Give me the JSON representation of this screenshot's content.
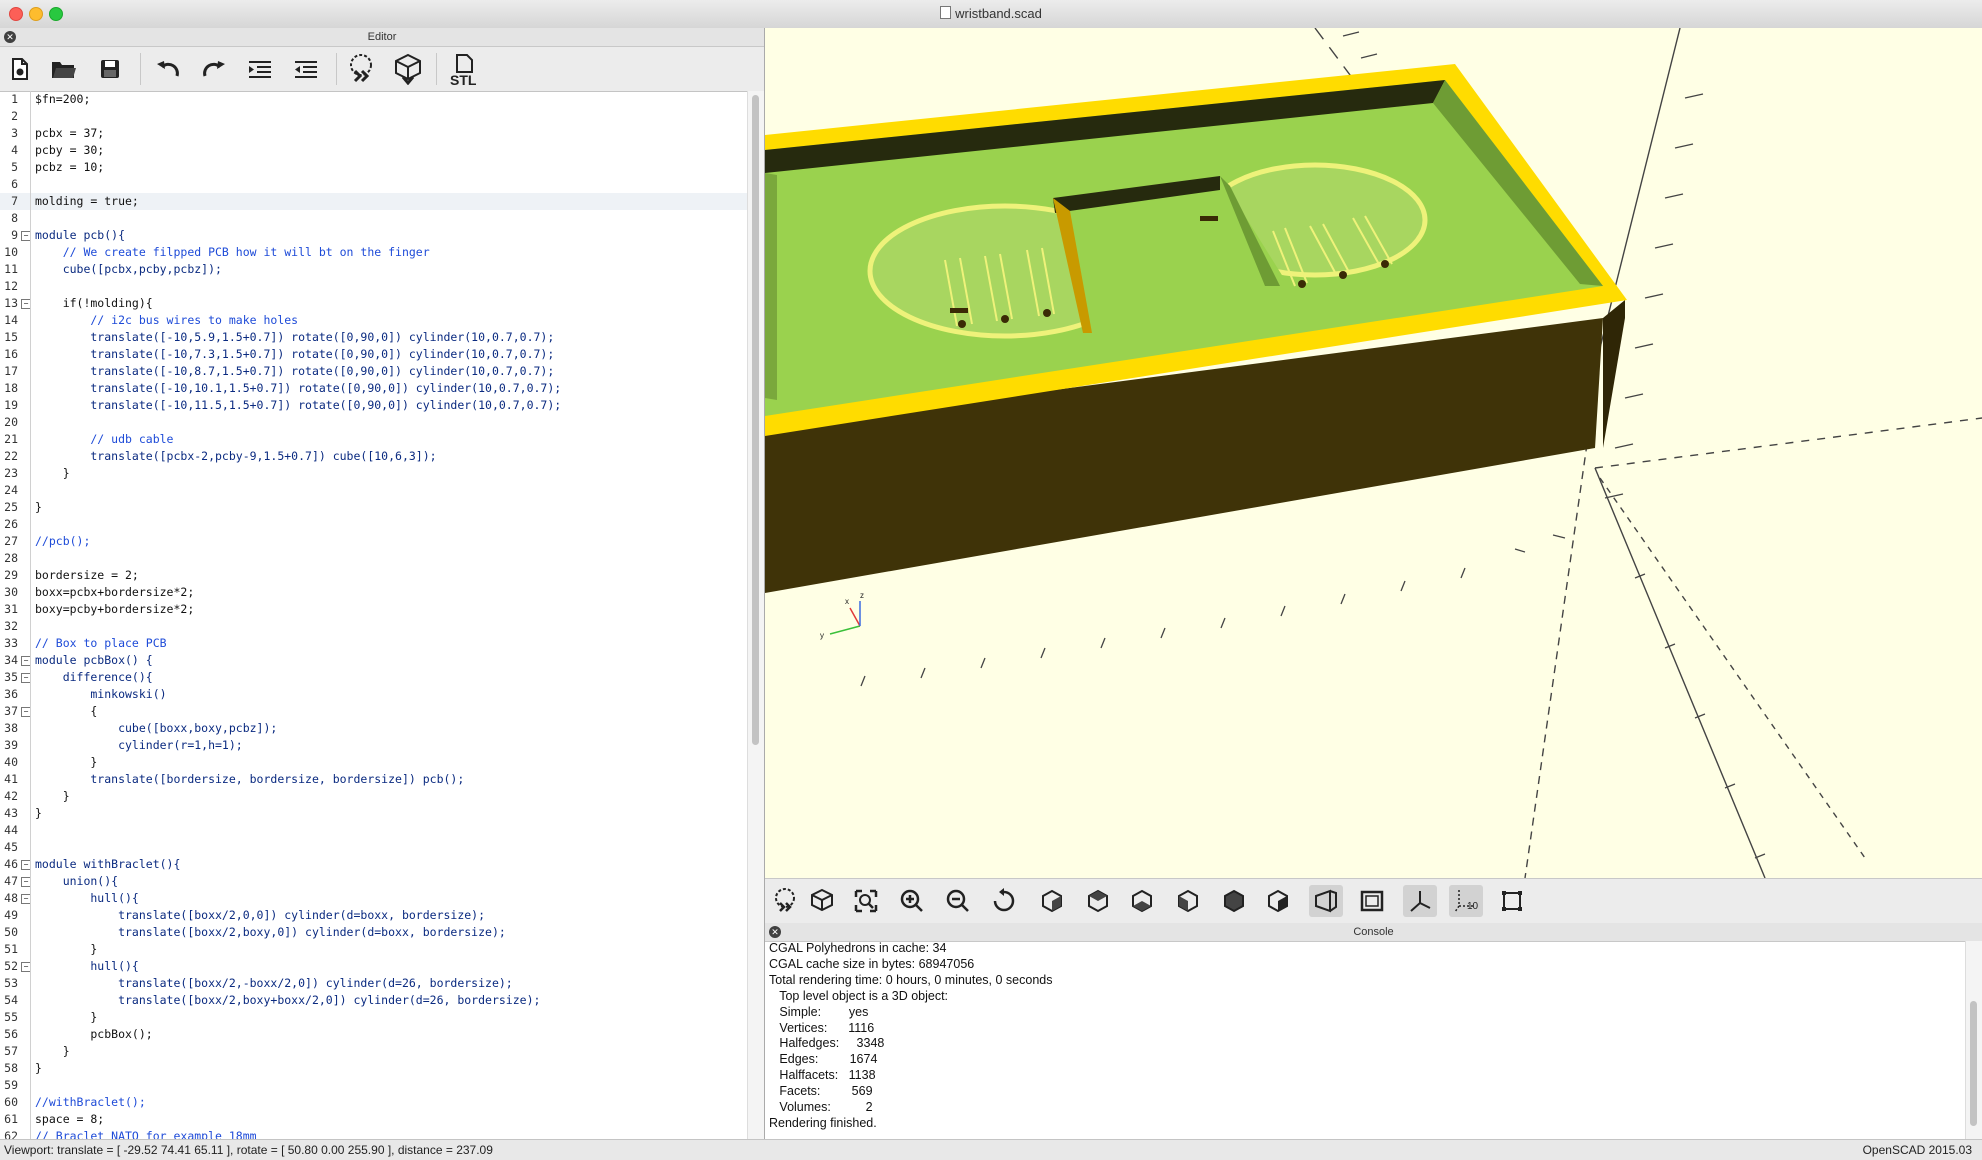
{
  "window": {
    "title": "wristband.scad"
  },
  "editor": {
    "title": "Editor",
    "toolbar": [
      "new-file-icon",
      "open-file-icon",
      "save-icon",
      "undo-icon",
      "redo-icon",
      "indent-icon",
      "unindent-icon",
      "preview-icon",
      "render-icon",
      "export-stl-icon"
    ],
    "stl_label": "STL",
    "lines": [
      {
        "n": "1",
        "t": "$fn=200;"
      },
      {
        "n": "2",
        "t": ""
      },
      {
        "n": "3",
        "t": "pcbx = 37;"
      },
      {
        "n": "4",
        "t": "pcby = 30;"
      },
      {
        "n": "5",
        "t": "pcbz = 10;"
      },
      {
        "n": "6",
        "t": ""
      },
      {
        "n": "7",
        "t": "molding = true;"
      },
      {
        "n": "8",
        "t": ""
      },
      {
        "n": "9",
        "t": "module pcb(){",
        "fold": true
      },
      {
        "n": "10",
        "t": "    // We create filpped PCB how it will bt on the finger"
      },
      {
        "n": "11",
        "t": "    cube([pcbx,pcby,pcbz]);"
      },
      {
        "n": "12",
        "t": ""
      },
      {
        "n": "13",
        "t": "    if(!molding){",
        "fold": true
      },
      {
        "n": "14",
        "t": "        // i2c bus wires to make holes"
      },
      {
        "n": "15",
        "t": "        translate([-10,5.9,1.5+0.7]) rotate([0,90,0]) cylinder(10,0.7,0.7);"
      },
      {
        "n": "16",
        "t": "        translate([-10,7.3,1.5+0.7]) rotate([0,90,0]) cylinder(10,0.7,0.7);"
      },
      {
        "n": "17",
        "t": "        translate([-10,8.7,1.5+0.7]) rotate([0,90,0]) cylinder(10,0.7,0.7);"
      },
      {
        "n": "18",
        "t": "        translate([-10,10.1,1.5+0.7]) rotate([0,90,0]) cylinder(10,0.7,0.7);"
      },
      {
        "n": "19",
        "t": "        translate([-10,11.5,1.5+0.7]) rotate([0,90,0]) cylinder(10,0.7,0.7);"
      },
      {
        "n": "20",
        "t": ""
      },
      {
        "n": "21",
        "t": "        // udb cable"
      },
      {
        "n": "22",
        "t": "        translate([pcbx-2,pcby-9,1.5+0.7]) cube([10,6,3]);"
      },
      {
        "n": "23",
        "t": "    }"
      },
      {
        "n": "24",
        "t": ""
      },
      {
        "n": "25",
        "t": "}"
      },
      {
        "n": "26",
        "t": ""
      },
      {
        "n": "27",
        "t": "//pcb();"
      },
      {
        "n": "28",
        "t": ""
      },
      {
        "n": "29",
        "t": "bordersize = 2;"
      },
      {
        "n": "30",
        "t": "boxx=pcbx+bordersize*2;"
      },
      {
        "n": "31",
        "t": "boxy=pcby+bordersize*2;"
      },
      {
        "n": "32",
        "t": ""
      },
      {
        "n": "33",
        "t": "// Box to place PCB"
      },
      {
        "n": "34",
        "t": "module pcbBox() {",
        "fold": true
      },
      {
        "n": "35",
        "t": "    difference(){",
        "fold": true
      },
      {
        "n": "36",
        "t": "        minkowski()"
      },
      {
        "n": "37",
        "t": "        {",
        "fold": true
      },
      {
        "n": "38",
        "t": "            cube([boxx,boxy,pcbz]);"
      },
      {
        "n": "39",
        "t": "            cylinder(r=1,h=1);"
      },
      {
        "n": "40",
        "t": "        }"
      },
      {
        "n": "41",
        "t": "        translate([bordersize, bordersize, bordersize]) pcb();"
      },
      {
        "n": "42",
        "t": "    }"
      },
      {
        "n": "43",
        "t": "}"
      },
      {
        "n": "44",
        "t": ""
      },
      {
        "n": "45",
        "t": ""
      },
      {
        "n": "46",
        "t": "module withBraclet(){",
        "fold": true
      },
      {
        "n": "47",
        "t": "    union(){",
        "fold": true
      },
      {
        "n": "48",
        "t": "        hull(){",
        "fold": true
      },
      {
        "n": "49",
        "t": "            translate([boxx/2,0,0]) cylinder(d=boxx, bordersize);"
      },
      {
        "n": "50",
        "t": "            translate([boxx/2,boxy,0]) cylinder(d=boxx, bordersize);"
      },
      {
        "n": "51",
        "t": "        }"
      },
      {
        "n": "52",
        "t": "        hull(){",
        "fold": true
      },
      {
        "n": "53",
        "t": "            translate([boxx/2,-boxx/2,0]) cylinder(d=26, bordersize);"
      },
      {
        "n": "54",
        "t": "            translate([boxx/2,boxy+boxx/2,0]) cylinder(d=26, bordersize);"
      },
      {
        "n": "55",
        "t": "        }"
      },
      {
        "n": "56",
        "t": "        pcbBox();"
      },
      {
        "n": "57",
        "t": "    }"
      },
      {
        "n": "58",
        "t": "}"
      },
      {
        "n": "59",
        "t": ""
      },
      {
        "n": "60",
        "t": "//withBraclet();"
      },
      {
        "n": "61",
        "t": "space = 8;"
      },
      {
        "n": "62",
        "t": "// Braclet NATO for example 18mm"
      }
    ]
  },
  "viewport_toolbar": [
    "preview-icon",
    "render-icon",
    "view-all-icon",
    "zoom-in-icon",
    "zoom-out-icon",
    "reset-view-icon",
    "view-right-icon",
    "view-top-icon",
    "view-bottom-icon",
    "view-left-icon",
    "view-front-icon",
    "view-back-icon",
    "perspective-icon",
    "orthogonal-icon",
    "show-axes-icon",
    "show-scale-markers-icon",
    "show-edges-icon"
  ],
  "scale_label": "10",
  "console": {
    "title": "Console",
    "lines": [
      "CGAL Polyhedrons in cache: 34",
      "CGAL cache size in bytes: 68947056",
      "Total rendering time: 0 hours, 0 minutes, 0 seconds",
      "   Top level object is a 3D object:",
      "   Simple:        yes",
      "   Vertices:      1116",
      "   Halfedges:     3348",
      "   Edges:         1674",
      "   Halffacets:   1138",
      "   Facets:         569",
      "   Volumes:          2",
      "Rendering finished."
    ]
  },
  "status": {
    "viewport": "Viewport: translate = [ -29.52 74.41 65.11 ], rotate = [ 50.80 0.00 255.90 ], distance = 237.09",
    "version": "OpenSCAD 2015.03"
  },
  "colors": {
    "top": "#9ad24e",
    "rim": "#ffdc00",
    "side": "#3f3308",
    "background": "#ffffe5"
  }
}
